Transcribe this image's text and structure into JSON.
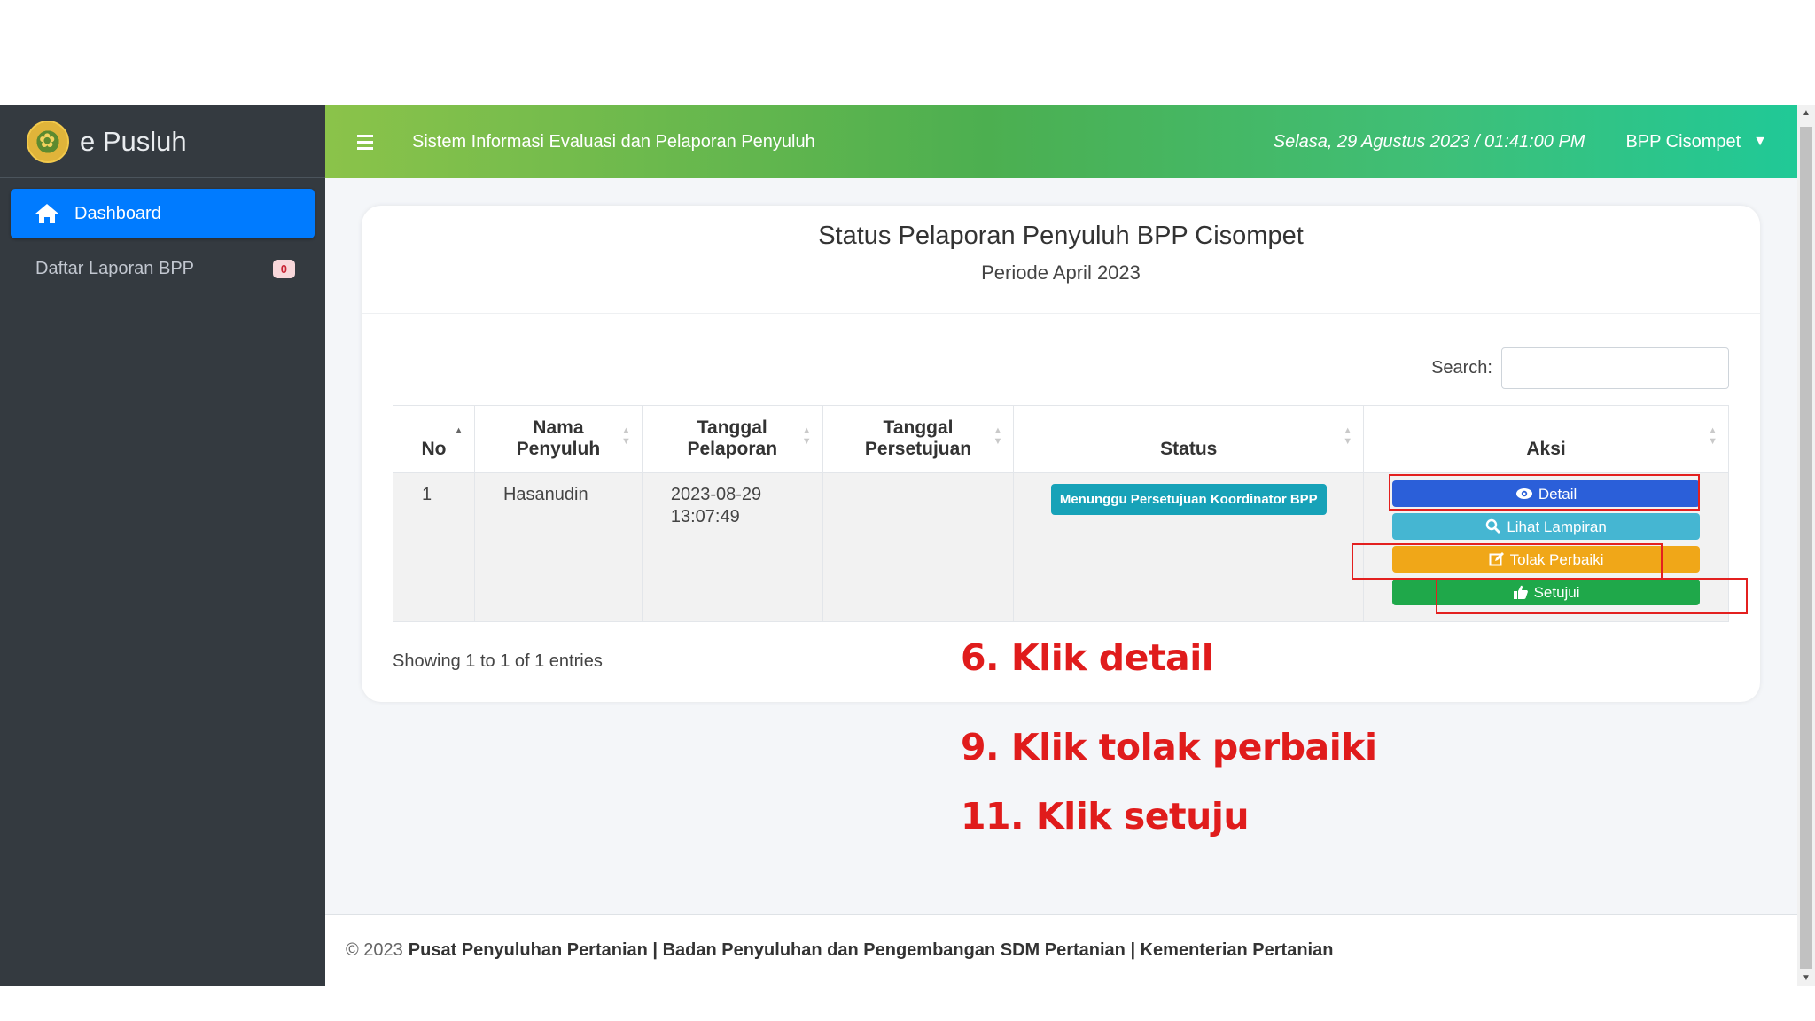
{
  "sidebar": {
    "brand": "e Pusluh",
    "items": [
      {
        "label": "Dashboard"
      },
      {
        "label": "Daftar Laporan BPP",
        "badge": "0"
      }
    ]
  },
  "header": {
    "title": "Sistem Informasi Evaluasi dan Pelaporan Penyuluh",
    "datetime": "Selasa, 29 Agustus 2023 / 01:41:00 PM",
    "user": "BPP Cisompet"
  },
  "card": {
    "title": "Status Pelaporan Penyuluh BPP Cisompet",
    "subtitle": "Periode April 2023",
    "search_label": "Search:",
    "search_value": "",
    "columns": [
      {
        "line1": "",
        "line2": "No"
      },
      {
        "line1": "Nama",
        "line2": "Penyuluh"
      },
      {
        "line1": "Tanggal",
        "line2": "Pelaporan"
      },
      {
        "line1": "Tanggal",
        "line2": "Persetujuan"
      },
      {
        "line1": "",
        "line2": "Status"
      },
      {
        "line1": "",
        "line2": "Aksi"
      }
    ],
    "rows": [
      {
        "no": "1",
        "nama": "Hasanudin",
        "tanggal_pelaporan_date": "2023-08-29",
        "tanggal_pelaporan_time": "13:07:49",
        "tanggal_persetujuan": "",
        "status": "Menunggu Persetujuan Koordinator BPP",
        "actions": {
          "detail": "Detail",
          "lampiran": "Lihat Lampiran",
          "tolak": "Tolak Perbaiki",
          "setuju": "Setujui"
        }
      }
    ],
    "info": "Showing 1 to 1 of 1 entries"
  },
  "annotations": {
    "step6": "6. Klik detail",
    "step9": "9. Klik tolak perbaiki",
    "step11": "11. Klik setuju"
  },
  "footer": {
    "copyright": "© 2023",
    "org": "Pusat Penyuluhan Pertanian | Badan Penyuluhan dan Pengembangan SDM Pertanian | Kementerian Pertanian"
  },
  "colors": {
    "sidebar": "#343a40",
    "active": "#007bff",
    "header_start": "#8bc34a",
    "header_end": "#20c997",
    "annotation": "#e01c1c"
  }
}
